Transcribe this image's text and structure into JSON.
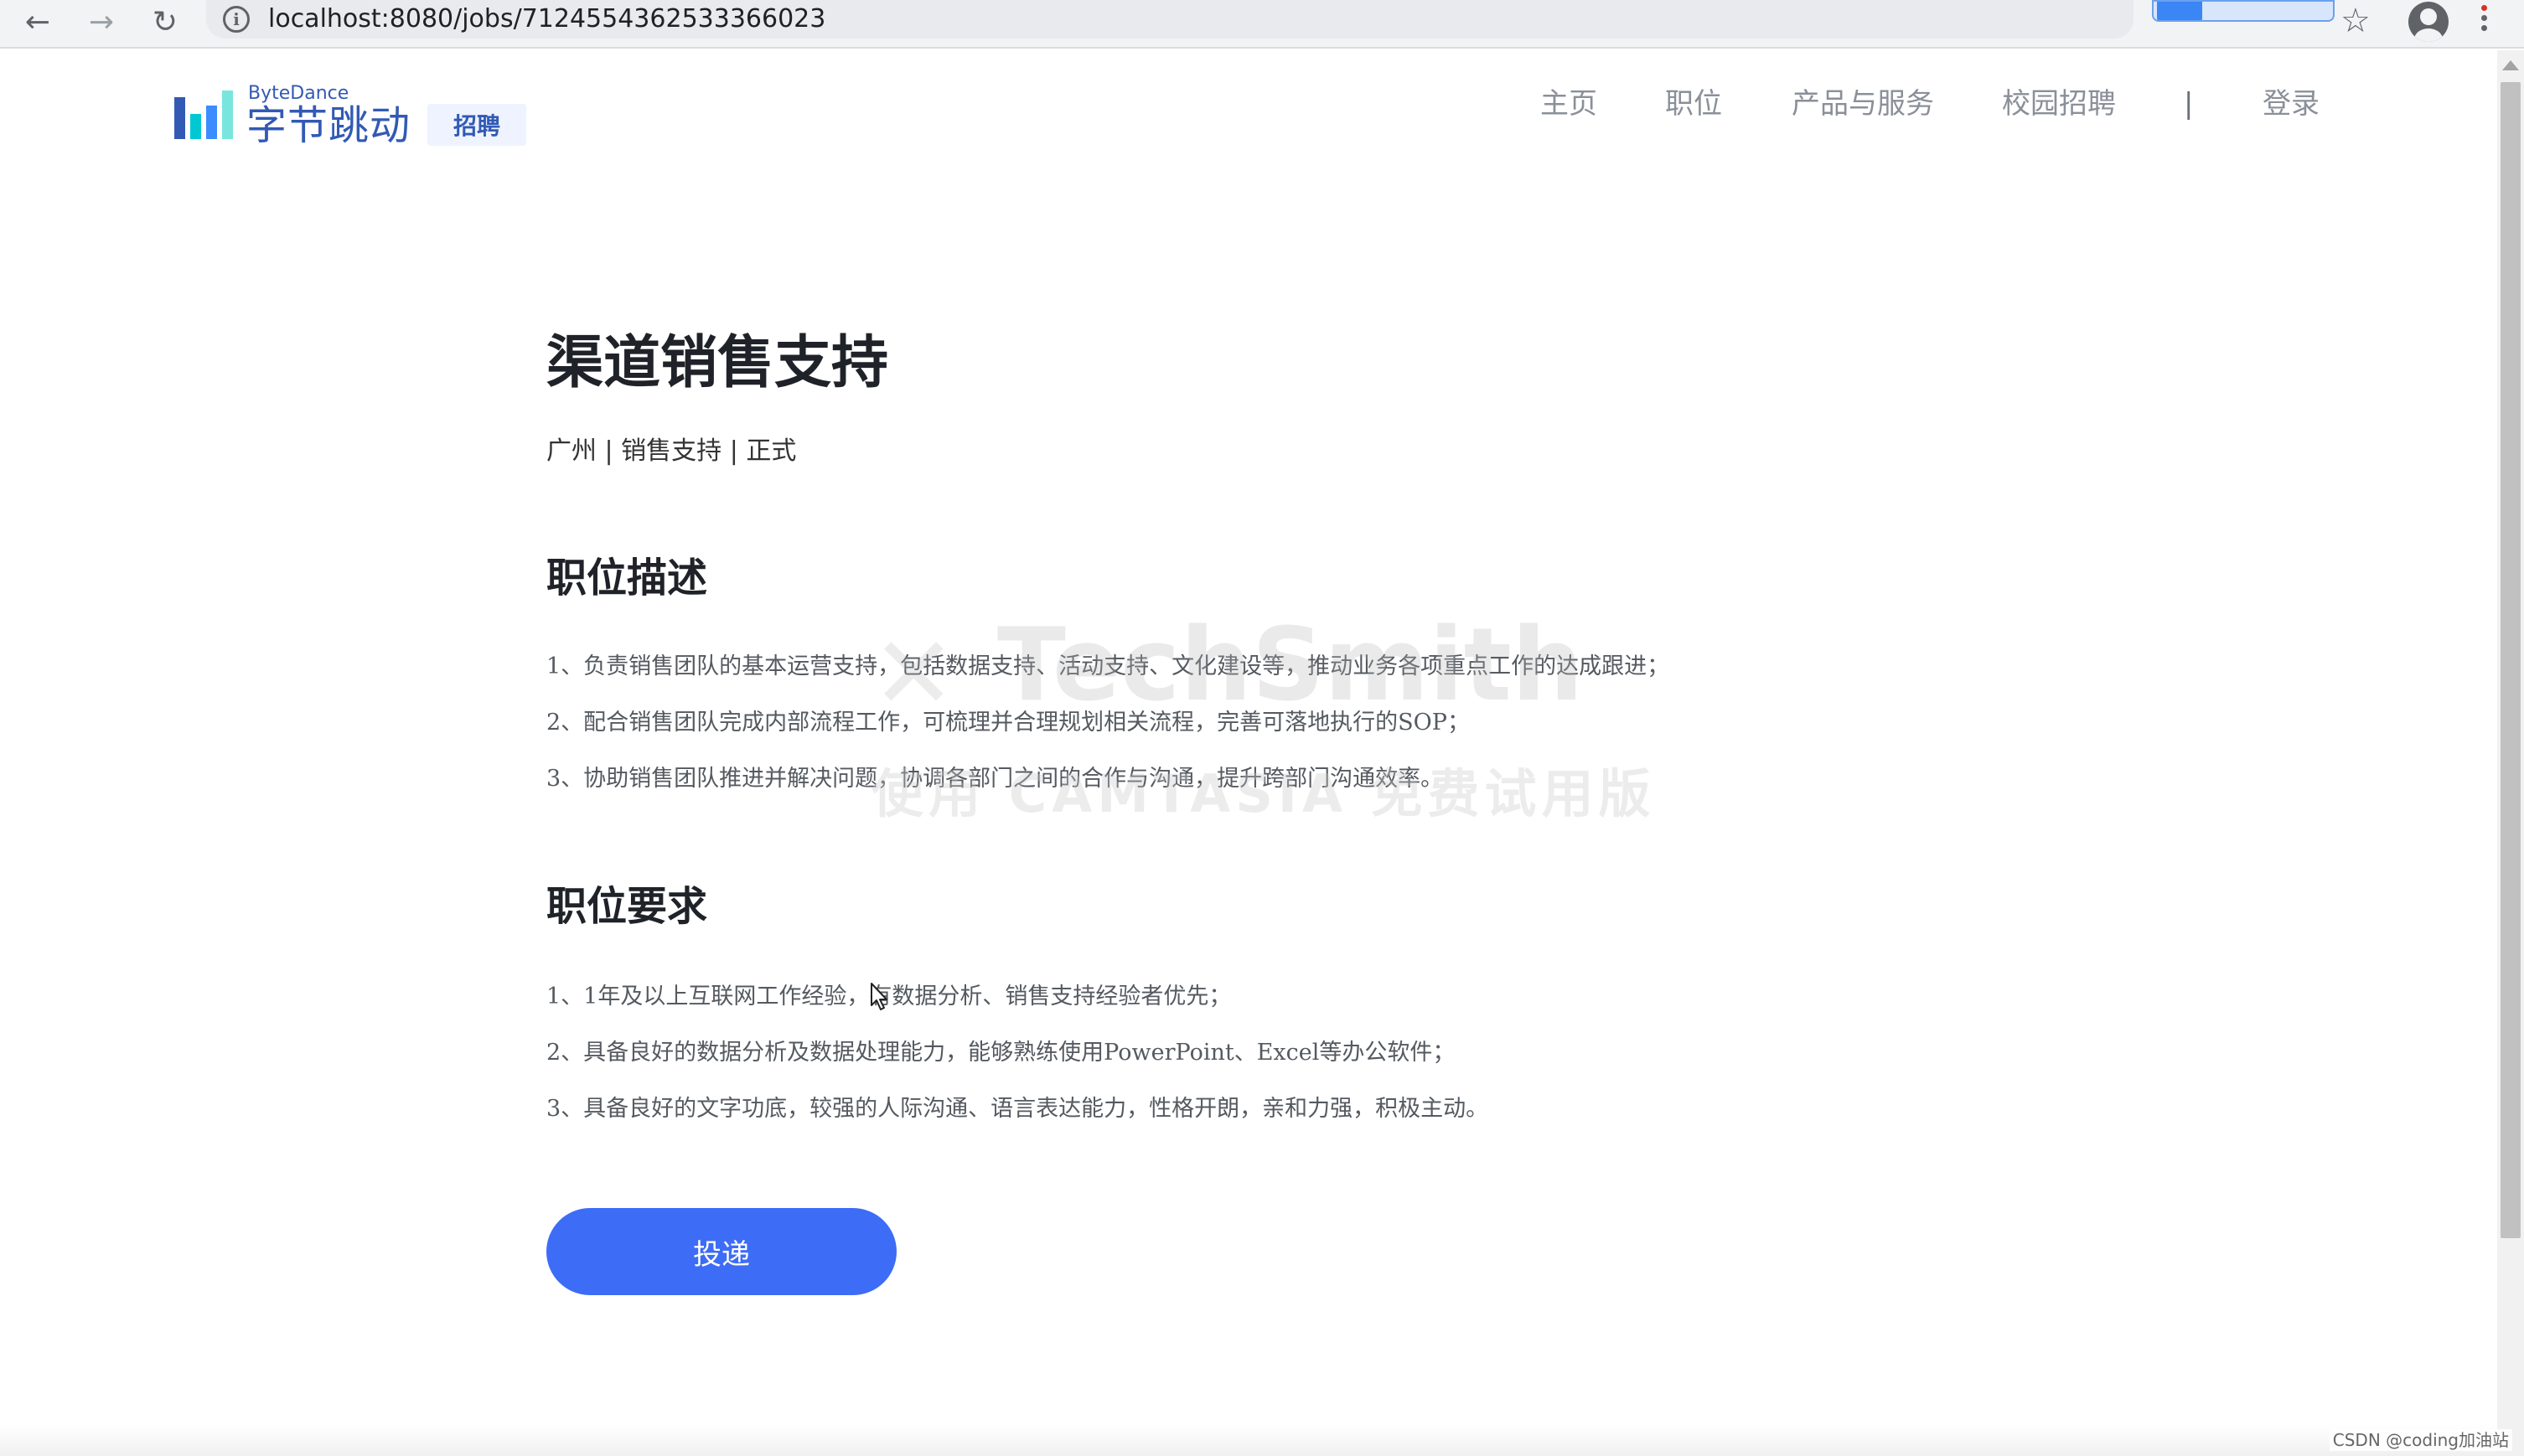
{
  "browser": {
    "url": "localhost:8080/jobs/7124554362533366023",
    "back_glyph": "←",
    "forward_glyph": "→",
    "reload_glyph": "↻",
    "info_glyph": "i",
    "star_glyph": "☆"
  },
  "header": {
    "logo_en": "ByteDance",
    "logo_cn": "字节跳动",
    "logo_tag": "招聘",
    "logo_colors": [
      "#325ab4",
      "#00c8d2",
      "#3c8cff",
      "#78e6dc"
    ],
    "nav": {
      "home": "主页",
      "jobs": "职位",
      "products": "产品与服务",
      "campus": "校园招聘",
      "divider": "|",
      "login": "登录"
    }
  },
  "job": {
    "title": "渠道销售支持",
    "meta": "广州 | 销售支持 | 正式",
    "description_title": "职位描述",
    "description": [
      "1、负责销售团队的基本运营支持，包括数据支持、活动支持、文化建设等，推动业务各项重点工作的达成跟进；",
      "2、配合销售团队完成内部流程工作，可梳理并合理规划相关流程，完善可落地执行的SOP；",
      "3、协助销售团队推进并解决问题，协调各部门之间的合作与沟通，提升跨部门沟通效率。"
    ],
    "requirements_title": "职位要求",
    "requirements": [
      "1、1年及以上互联网工作经验，有数据分析、销售支持经验者优先；",
      "2、具备良好的数据分析及数据处理能力，能够熟练使用PowerPoint、Excel等办公软件；",
      "3、具备良好的文字功底，较强的人际沟通、语言表达能力，性格开朗，亲和力强，积极主动。"
    ],
    "apply_label": "投递",
    "accent_color": "#3d6cf6"
  },
  "watermark": {
    "brand": "TechSmith",
    "sub": "使用 CAMTASIA 免费试用版"
  },
  "footer": {
    "credit": "CSDN @coding加油站"
  }
}
